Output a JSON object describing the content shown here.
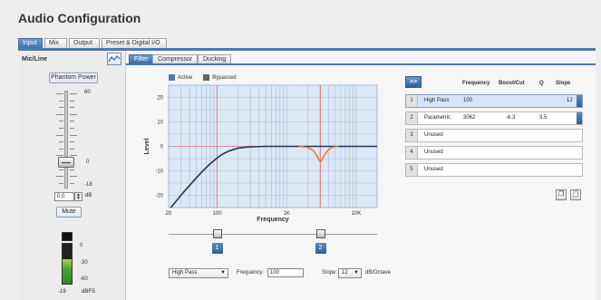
{
  "window": {
    "title": "Audio Configuration"
  },
  "main_tabs": [
    {
      "label": "Input",
      "active": true
    },
    {
      "label": "Mix",
      "active": false
    },
    {
      "label": "Output",
      "active": false
    },
    {
      "label": "Preset & Digital I/O",
      "active": false
    }
  ],
  "input": {
    "section_label": "Mic/Line",
    "phantom_power_label": "Phantom Power",
    "fader_scale": [
      "60",
      "0",
      "-18"
    ],
    "gain_value": "0.0",
    "gain_unit": "dB",
    "mute_label": "Mute",
    "meter_scale": [
      "0",
      "-30",
      "-60"
    ],
    "meter_reading": "-19",
    "meter_unit": "dBFS",
    "meter_level_fraction": 0.62
  },
  "sub_tabs": [
    {
      "label": "Filter",
      "active": true
    },
    {
      "label": "Compressor",
      "active": false
    },
    {
      "label": "Ducking",
      "active": false
    }
  ],
  "legend": {
    "active_label": "Active",
    "bypassed_label": "Bypassed",
    "active_color": "#4a7ab3",
    "bypassed_color": "#666666"
  },
  "chart_data": {
    "type": "line",
    "xlabel": "Frequency",
    "ylabel": "Level",
    "x_scale": "log",
    "xlim": [
      20,
      20000
    ],
    "ylim": [
      -25,
      25
    ],
    "x_ticks": [
      "20",
      "100",
      "1K",
      "10K"
    ],
    "y_ticks": [
      "20",
      "10",
      "0",
      "-10",
      "-20"
    ],
    "series": [
      {
        "color": "#223355",
        "x": [
          20,
          25,
          30,
          40,
          50,
          60,
          70,
          80,
          100,
          120,
          150,
          200,
          300,
          500,
          20000
        ],
        "y": [
          -26,
          -22.8,
          -20,
          -16,
          -12.9,
          -10.5,
          -8.6,
          -7,
          -4.7,
          -3.1,
          -1.8,
          -0.7,
          -0.2,
          0,
          0
        ]
      },
      {
        "color": "#f07a3a",
        "x": [
          1500,
          2000,
          2400,
          2700,
          2900,
          3062,
          3250,
          3500,
          3900,
          4500,
          5500
        ],
        "y": [
          0,
          -0.4,
          -1.6,
          -3.6,
          -5.3,
          -6.3,
          -5.3,
          -3.6,
          -1.6,
          -0.4,
          0
        ]
      }
    ],
    "markers": [
      {
        "label": "1",
        "x": 100
      },
      {
        "label": "2",
        "x": 3062
      }
    ],
    "grid": true
  },
  "band_controls": {
    "type_value": "High Pass",
    "frequency_label": "Frequency:",
    "frequency_value": "100",
    "slope_label": "Slope:",
    "slope_value": "12",
    "slope_unit": "dB/Octave"
  },
  "band_table": {
    "expand_label": ">>",
    "headers": [
      "Frequency",
      "Boost/Cut",
      "Q",
      "Slope"
    ],
    "rows": [
      {
        "num": "1",
        "type": "High Pass",
        "frequency": "100",
        "boost": "",
        "q": "",
        "slope": "12",
        "selected": true
      },
      {
        "num": "2",
        "type": "Parametric",
        "frequency": "3062",
        "boost": "-6.3",
        "q": "3.5",
        "slope": "",
        "selected": false
      },
      {
        "num": "3",
        "type": "Unused",
        "frequency": "",
        "boost": "",
        "q": "",
        "slope": "",
        "selected": false
      },
      {
        "num": "4",
        "type": "Unused",
        "frequency": "",
        "boost": "",
        "q": "",
        "slope": "",
        "selected": false
      },
      {
        "num": "5",
        "type": "Unused",
        "frequency": "",
        "boost": "",
        "q": "",
        "slope": "",
        "selected": false
      }
    ]
  },
  "icons": {
    "eq_toggle": "eq-curve-icon",
    "copy": "copy-icon",
    "paste": "paste-icon"
  }
}
